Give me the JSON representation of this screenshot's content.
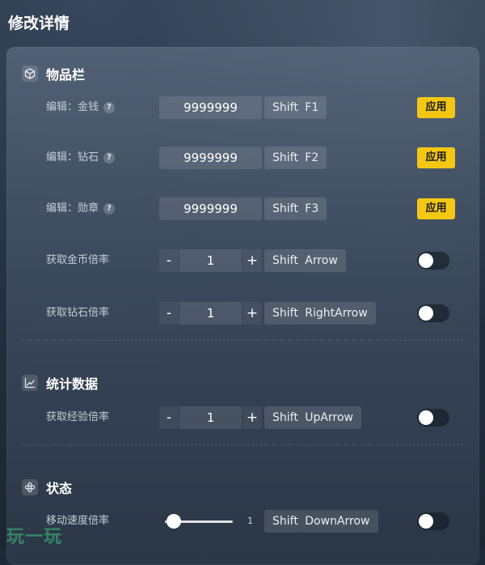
{
  "page_title": "修改详情",
  "sections": {
    "inventory": {
      "title": "物品栏",
      "icon": "cube-icon",
      "rows": [
        {
          "label": "编辑：金钱",
          "value": "9999999",
          "hotkey": "Shift F1",
          "action": "应用"
        },
        {
          "label": "编辑：钻石",
          "value": "9999999",
          "hotkey": "Shift F2",
          "action": "应用"
        },
        {
          "label": "编辑：勋章",
          "value": "9999999",
          "hotkey": "Shift F3",
          "action": "应用"
        },
        {
          "label": "获取金币倍率",
          "value": "1",
          "hotkey": "Shift Arrow",
          "enabled": false
        },
        {
          "label": "获取钻石倍率",
          "value": "1",
          "hotkey": "Shift RightArrow",
          "enabled": false
        }
      ]
    },
    "stats": {
      "title": "统计数据",
      "icon": "chart-icon",
      "rows": [
        {
          "label": "获取经验倍率",
          "value": "1",
          "hotkey": "Shift UpArrow",
          "enabled": false
        }
      ]
    },
    "status": {
      "title": "状态",
      "icon": "move-icon",
      "rows": [
        {
          "label": "移动速度倍率",
          "value": "1",
          "slider_fraction": 0.0,
          "hotkey": "Shift DownArrow",
          "enabled": false
        }
      ]
    }
  },
  "stepper": {
    "minus": "-",
    "plus": "+"
  },
  "help_glyph": "?",
  "watermark": "玩一玩",
  "colors": {
    "accent": "#f4c715",
    "panel": "#3e4c5f",
    "background": "#1f2a38"
  }
}
